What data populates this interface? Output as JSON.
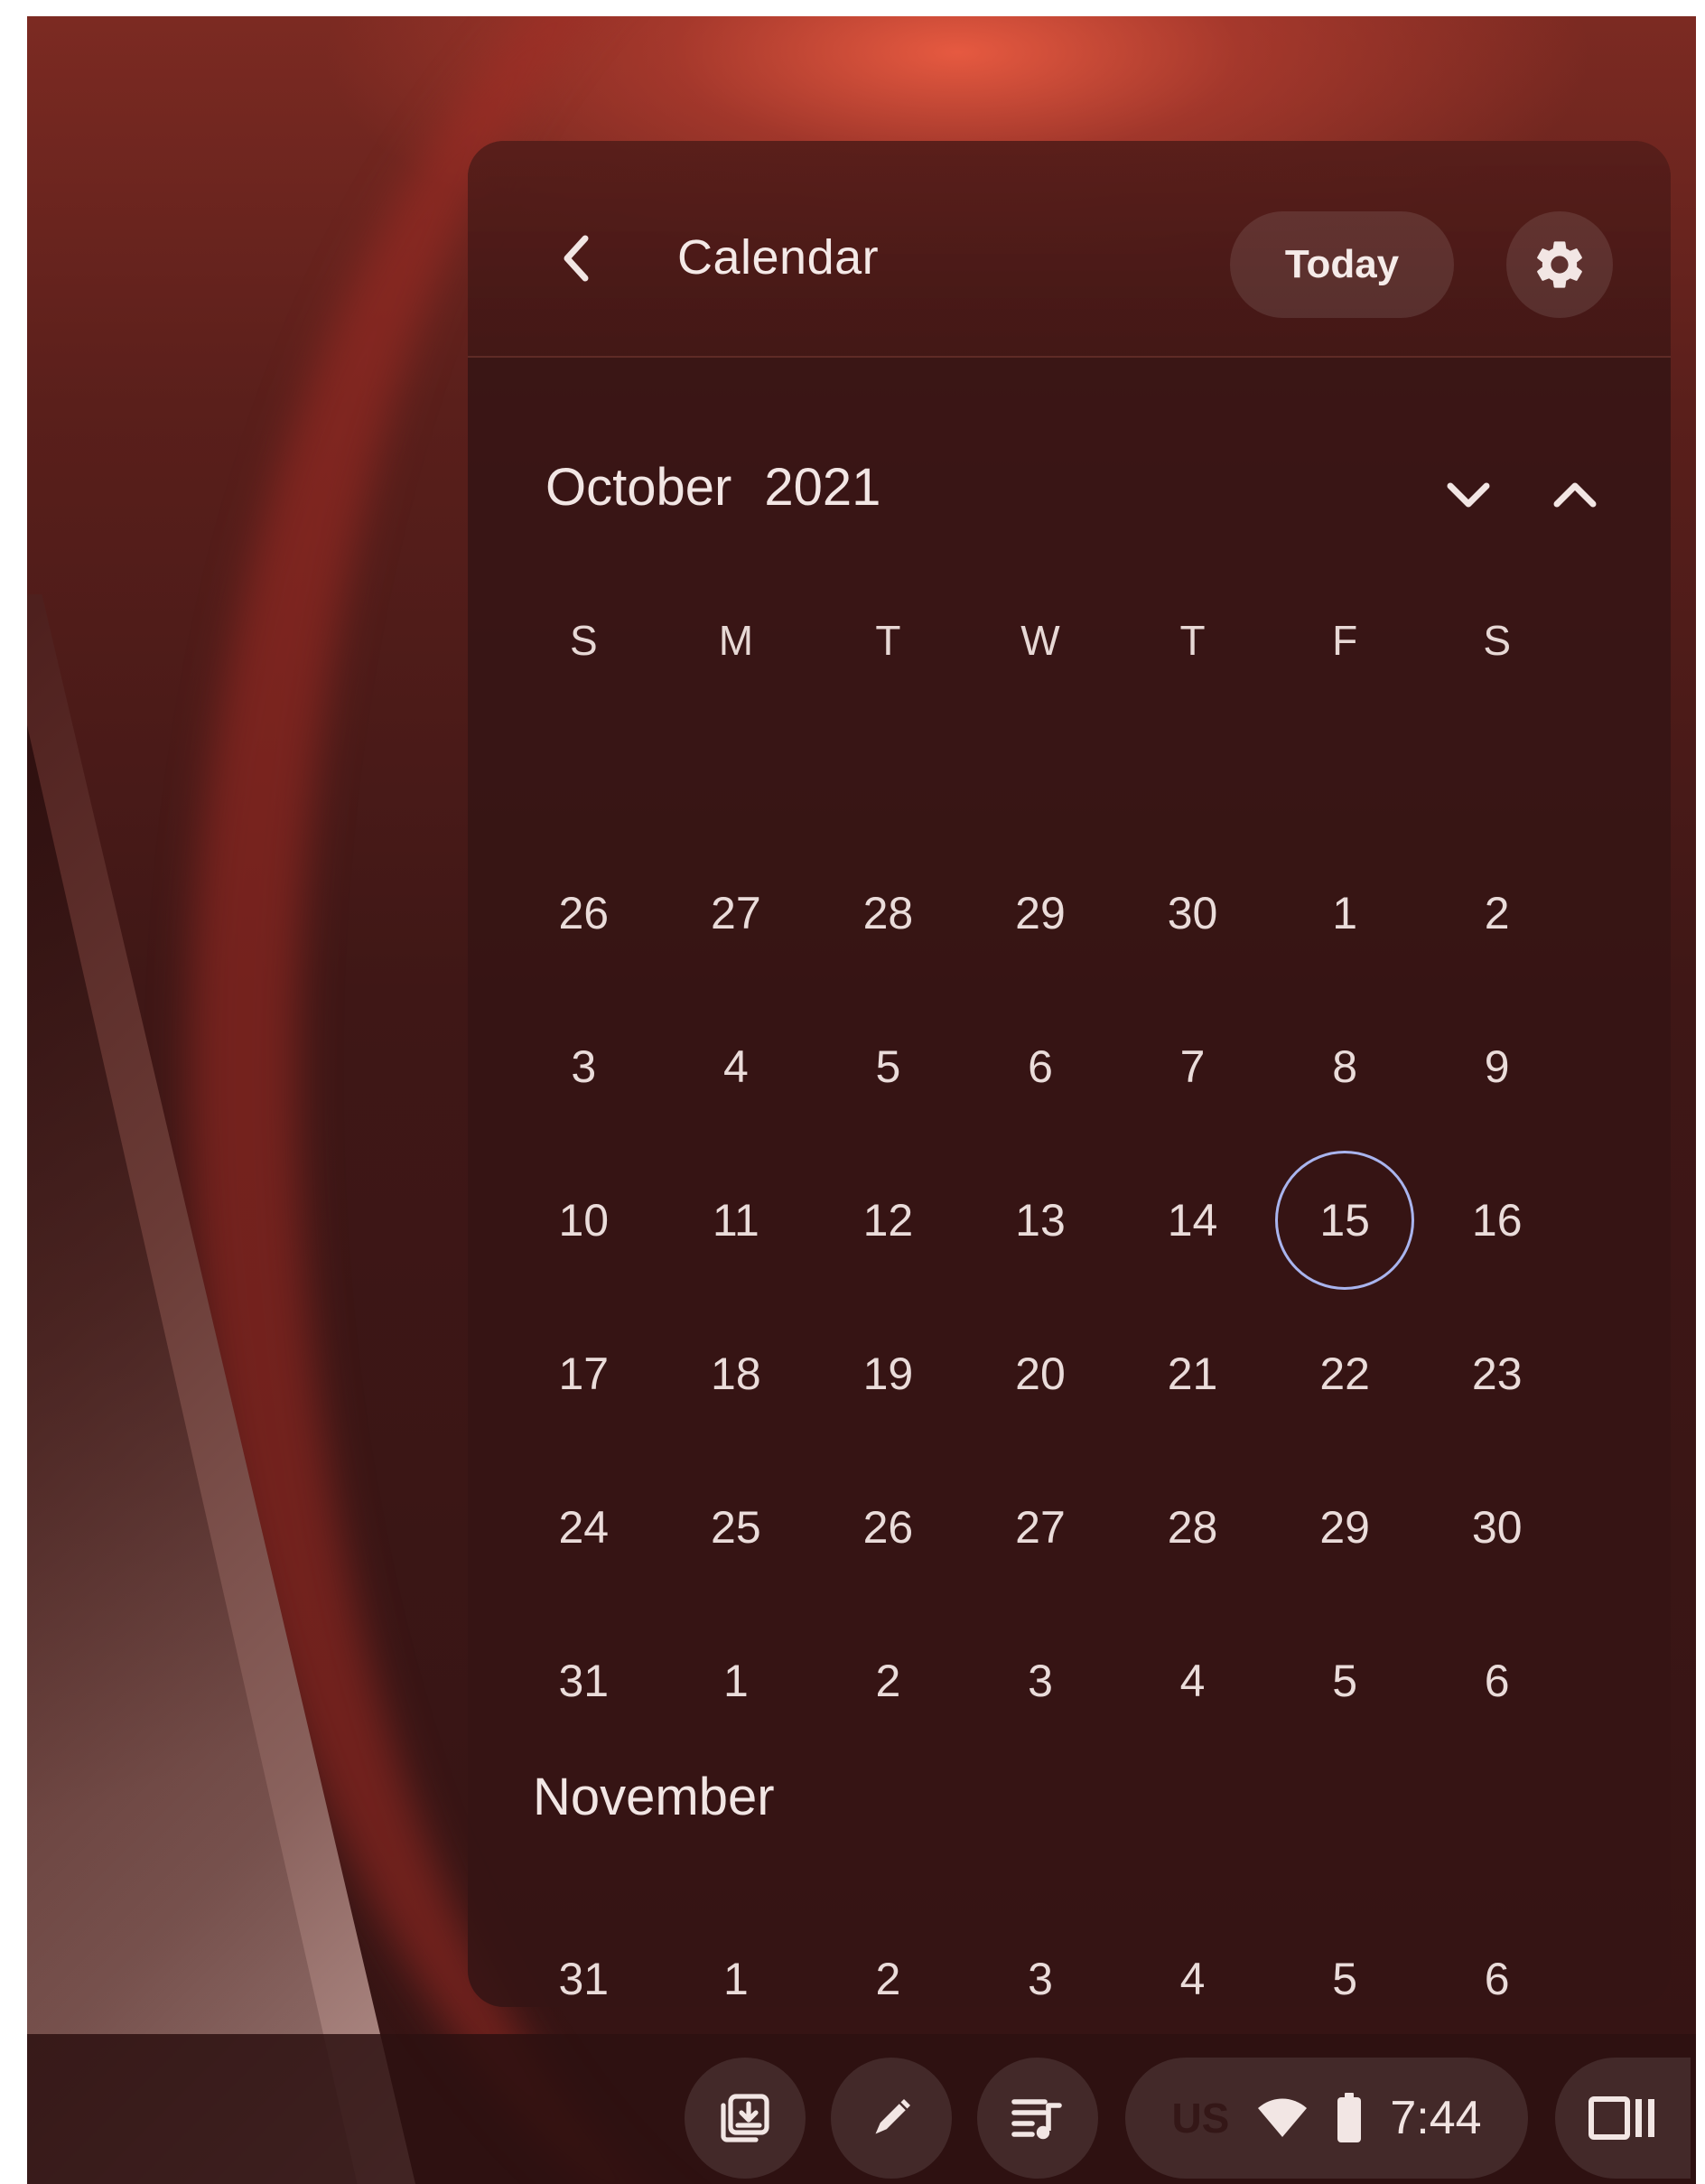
{
  "header": {
    "title": "Calendar",
    "today_label": "Today"
  },
  "month": {
    "name": "October",
    "year": "2021"
  },
  "weekdays": [
    "S",
    "M",
    "T",
    "W",
    "T",
    "F",
    "S"
  ],
  "weeks": [
    [
      "26",
      "27",
      "28",
      "29",
      "30",
      "1",
      "2"
    ],
    [
      "3",
      "4",
      "5",
      "6",
      "7",
      "8",
      "9"
    ],
    [
      "10",
      "11",
      "12",
      "13",
      "14",
      "15",
      "16"
    ],
    [
      "17",
      "18",
      "19",
      "20",
      "21",
      "22",
      "23"
    ],
    [
      "24",
      "25",
      "26",
      "27",
      "28",
      "29",
      "30"
    ],
    [
      "31",
      "1",
      "2",
      "3",
      "4",
      "5",
      "6"
    ]
  ],
  "today": "15",
  "next_month": {
    "name": "November",
    "week": [
      "31",
      "1",
      "2",
      "3",
      "4",
      "5",
      "6"
    ]
  },
  "shelf": {
    "ime": "US",
    "time": "7:44"
  },
  "colors": {
    "today_ring": "#a9b4ee",
    "panel_bg": "#361414",
    "text": "#eadcda"
  }
}
